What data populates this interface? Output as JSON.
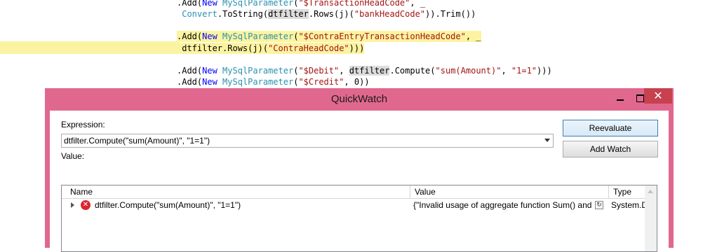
{
  "code": {
    "line1": [
      {
        "t": ".Add(",
        "c": ""
      },
      {
        "t": "New",
        "c": "kw"
      },
      {
        "t": " ",
        "c": ""
      },
      {
        "t": "MySqlParameter",
        "c": "ty"
      },
      {
        "t": "(",
        "c": ""
      },
      {
        "t": "\"$TransactionHeadCode\"",
        "c": "st"
      },
      {
        "t": ", _",
        "c": ""
      }
    ],
    "line2": [
      {
        "t": " ",
        "c": ""
      },
      {
        "t": "Convert",
        "c": "ty"
      },
      {
        "t": ".ToString(",
        "c": ""
      },
      {
        "t": "dtfilter",
        "c": "ref"
      },
      {
        "t": ".Rows(j)(",
        "c": ""
      },
      {
        "t": "\"bankHeadCode\"",
        "c": "st"
      },
      {
        "t": ")).Trim())",
        "c": ""
      }
    ],
    "line3": [
      {
        "t": ".Add(",
        "c": ""
      },
      {
        "t": "New",
        "c": "kw"
      },
      {
        "t": " ",
        "c": ""
      },
      {
        "t": "MySqlParameter",
        "c": "ty"
      },
      {
        "t": "(",
        "c": ""
      },
      {
        "t": "\"$ContraEntryTransactionHeadCode\"",
        "c": "st"
      },
      {
        "t": ", _",
        "c": ""
      }
    ],
    "line4": [
      {
        "t": " ",
        "c": ""
      },
      {
        "t": "dtfilter",
        "c": ""
      },
      {
        "t": ".Rows(j)(",
        "c": ""
      },
      {
        "t": "\"ContraHeadCode\"",
        "c": "st"
      },
      {
        "t": ")))",
        "c": ""
      }
    ],
    "line5": [
      {
        "t": ".Add(",
        "c": ""
      },
      {
        "t": "New",
        "c": "kw"
      },
      {
        "t": " ",
        "c": ""
      },
      {
        "t": "MySqlParameter",
        "c": "ty"
      },
      {
        "t": "(",
        "c": ""
      },
      {
        "t": "\"$Debit\"",
        "c": "st"
      },
      {
        "t": ", ",
        "c": ""
      },
      {
        "t": "dtfilter",
        "c": "ref"
      },
      {
        "t": ".Compute(",
        "c": ""
      },
      {
        "t": "\"sum(Amount)\"",
        "c": "st"
      },
      {
        "t": ", ",
        "c": ""
      },
      {
        "t": "\"1=1\"",
        "c": "st"
      },
      {
        "t": ")))",
        "c": ""
      }
    ],
    "line6": [
      {
        "t": ".Add(",
        "c": ""
      },
      {
        "t": "New",
        "c": "kw"
      },
      {
        "t": " ",
        "c": ""
      },
      {
        "t": "MySqlParameter",
        "c": "ty"
      },
      {
        "t": "(",
        "c": ""
      },
      {
        "t": "\"$Credit\"",
        "c": "st"
      },
      {
        "t": ", 0))",
        "c": ""
      }
    ]
  },
  "dialog": {
    "title": "QuickWatch",
    "close_glyph": "✕",
    "expression_label": "Expression:",
    "expression_value": "dtfilter.Compute(\"sum(Amount)\", \"1=1\")",
    "value_label": "Value:",
    "reevaluate_label": "Reevaluate",
    "add_watch_label": "Add Watch",
    "columns": {
      "name": "Name",
      "value": "Value",
      "type": "Type"
    },
    "row": {
      "name": "dtfilter.Compute(\"sum(Amount)\", \"1=1\")",
      "value": "{\"Invalid usage of aggregate function Sum() and Type: Object.\"}",
      "type": "System.Data.SyntaxErrorException",
      "error_glyph": "✕",
      "refresh_glyph": "↻"
    }
  },
  "colors": {
    "dialog_frame": "#e0688f",
    "close_button": "#c7414e",
    "edit_highlight": "#fbf3a0",
    "keyword": "#0000ff",
    "type": "#2b91af",
    "string": "#a31515"
  }
}
